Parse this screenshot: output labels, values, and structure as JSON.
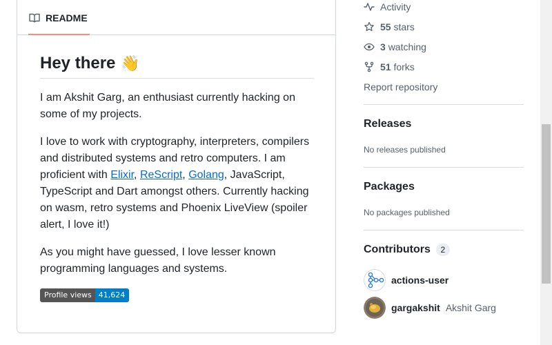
{
  "readme": {
    "tab_label": "README",
    "title": "Hey there",
    "title_emoji": "👋",
    "paragraph1": "I am Akshit Garg, an enthusiast currently hacking on some of my projects.",
    "paragraph2": {
      "prefix": "I love to work with cryptography, interpreters, compilers and distributed systems and retro computers. I am proficient with ",
      "link1": "Elixir",
      "sep1": ", ",
      "link2": "ReScript",
      "sep2": ", ",
      "link3": "Golang",
      "suffix": ", JavaScript, TypeScript and Dart amongst others. Currently hacking on wasm, retro systems and Phoenix LiveView (spoiler alert, I love it!)"
    },
    "paragraph3": "As you might have guessed, I love lesser known programming languages and systems.",
    "badge": {
      "label": "Profile views",
      "value": "41,624"
    }
  },
  "sidebar": {
    "activity": "Activity",
    "stars": {
      "count": "55",
      "label": "stars"
    },
    "watching": {
      "count": "3",
      "label": "watching"
    },
    "forks": {
      "count": "51",
      "label": "forks"
    },
    "report": "Report repository",
    "releases": {
      "title": "Releases",
      "note": "No releases published"
    },
    "packages": {
      "title": "Packages",
      "note": "No packages published"
    },
    "contributors": {
      "title": "Contributors",
      "count": "2",
      "items": [
        {
          "login": "actions-user",
          "name": ""
        },
        {
          "login": "gargakshit",
          "name": "Akshit Garg"
        }
      ]
    }
  },
  "colors": {
    "accent_link": "#0969da",
    "tab_underline": "#fd8c73",
    "badge_left": "#555555",
    "badge_right": "#007ec6"
  }
}
